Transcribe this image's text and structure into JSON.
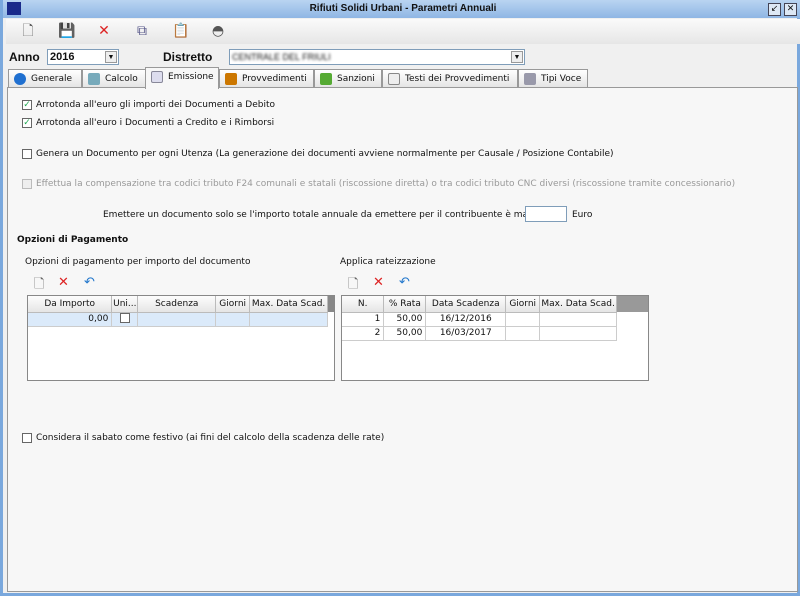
{
  "window": {
    "title": "Rifiuti Solidi Urbani - Parametri Annuali"
  },
  "toolbar": [
    "new-icon",
    "save-icon",
    "delete-icon",
    "copy-icon",
    "paste-icon",
    "camera-icon"
  ],
  "filters": {
    "anno_label": "Anno",
    "anno_value": "2016",
    "distretto_label": "Distretto",
    "distretto_value": "CENTRALE DEL FRIULI"
  },
  "tabs": [
    {
      "label": "Generale"
    },
    {
      "label": "Calcolo"
    },
    {
      "label": "Emissione"
    },
    {
      "label": "Provvedimenti"
    },
    {
      "label": "Sanzioni"
    },
    {
      "label": "Testi dei Provvedimenti"
    },
    {
      "label": "Tipi Voce"
    }
  ],
  "options": {
    "arrotonda_debito": "Arrotonda all'euro gli importi dei Documenti a Debito",
    "arrotonda_credito": "Arrotonda all'euro i Documenti a Credito e i Rimborsi",
    "genera_documento": "Genera un Documento per ogni Utenza (La generazione dei documenti avviene normalmente per Causale / Posizione Contabile)",
    "compensazione": "Effettua la compensazione tra codici tributo F24 comunali e statali (riscossione diretta) o tra codici tributo CNC diversi (riscossione tramite concessionario)",
    "emettere_label": "Emettere un documento solo se l'importo totale annuale da emettere per il contribuente è maggiore di",
    "emettere_value": "",
    "euro": "Euro",
    "sabato": "Considera il sabato come festivo (ai fini del calcolo della scadenza delle rate)"
  },
  "pagamento": {
    "title": "Opzioni di Pagamento",
    "left_title": "Opzioni di pagamento per importo del documento",
    "left_headers": [
      "Da Importo",
      "Uni...",
      "Scadenza",
      "Giorni",
      "Max. Data Scad."
    ],
    "left_rows": [
      [
        "0,00",
        "",
        "",
        "",
        ""
      ]
    ],
    "right_title": "Applica rateizzazione",
    "right_headers": [
      "N.",
      "% Rata",
      "Data Scadenza",
      "Giorni",
      "Max. Data Scad."
    ],
    "right_rows": [
      [
        "1",
        "50,00",
        "16/12/2016",
        "",
        ""
      ],
      [
        "2",
        "50,00",
        "16/03/2017",
        "",
        ""
      ]
    ]
  }
}
